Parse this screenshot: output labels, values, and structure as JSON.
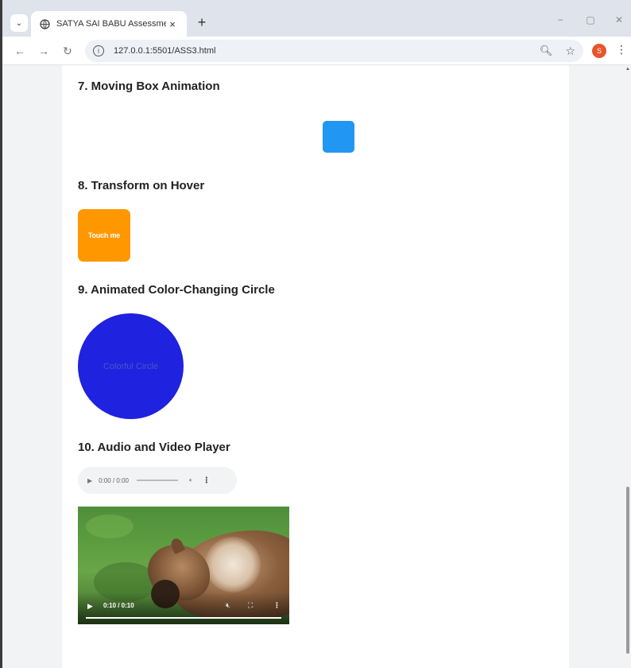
{
  "browser": {
    "tab_title": "SATYA SAI BABU Assessment",
    "tab_close": "×",
    "new_tab": "+",
    "url": "127.0.0.1:5501/ASS3.html",
    "profile_initial": "S",
    "win_minimize": "−",
    "win_maximize": "▢",
    "win_close": "✕"
  },
  "sections": {
    "s7": {
      "title": "7. Moving Box Animation"
    },
    "s8": {
      "title": "8. Transform on Hover",
      "box_label": "Touch me"
    },
    "s9": {
      "title": "9. Animated Color-Changing Circle",
      "circle_label": "Colorful Circle"
    },
    "s10": {
      "title": "10. Audio and Video Player"
    }
  },
  "audio": {
    "time": "0:00 / 0:00"
  },
  "video": {
    "time": "0:10 / 0:10"
  },
  "colors": {
    "moving_box": "#2196f3",
    "touch_box": "#ff9800",
    "circle": "#1f22de"
  }
}
